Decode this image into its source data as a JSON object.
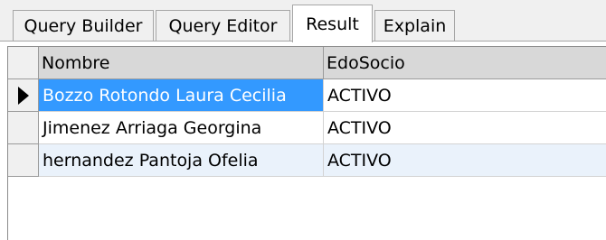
{
  "tabs": [
    "Query Builder",
    "Query Editor",
    "Result",
    "Explain"
  ],
  "active_tab": "Result",
  "grid": {
    "columns": [
      "Nombre",
      "EdoSocio"
    ],
    "rows": [
      {
        "Nombre": "Bozzo Rotondo Laura Cecilia",
        "EdoSocio": "ACTIVO"
      },
      {
        "Nombre": "Jimenez Arriaga Georgina",
        "EdoSocio": "ACTIVO"
      },
      {
        "Nombre": "hernandez Pantoja Ofelia",
        "EdoSocio": "ACTIVO"
      }
    ],
    "current_row_icon": "row-pointer-icon",
    "selection_color": "#3399ff",
    "alt_row_color": "#eaf2fb"
  }
}
